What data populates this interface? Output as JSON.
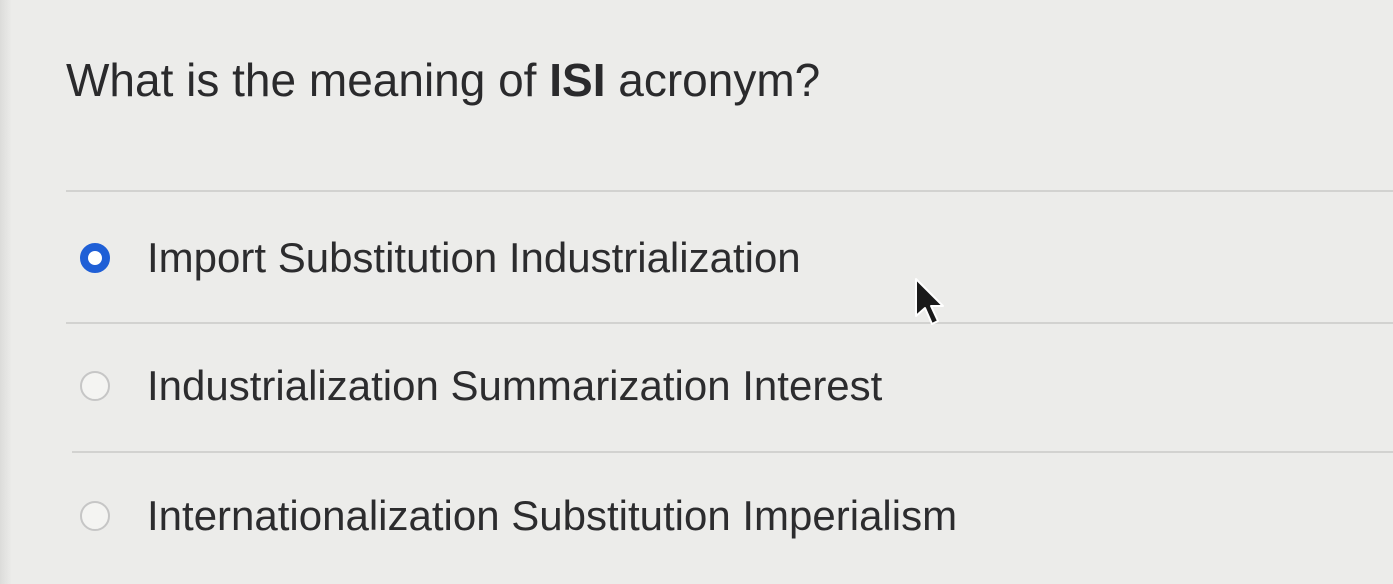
{
  "question": {
    "prefix": "What is the meaning of ",
    "emphasis": "ISI",
    "suffix": " acronym?"
  },
  "options": [
    {
      "label": "Import Substitution Industrialization",
      "selected": true
    },
    {
      "label": "Industrialization Summarization Interest",
      "selected": false
    },
    {
      "label": "Internationalization Substitution Imperialism",
      "selected": false
    }
  ],
  "colors": {
    "selected_radio": "#1f5fd6",
    "background": "#ececea"
  }
}
